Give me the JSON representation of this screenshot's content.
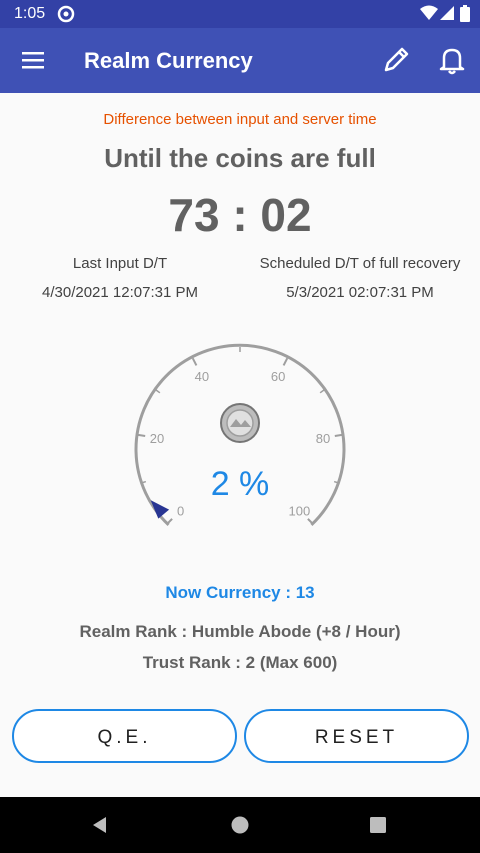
{
  "status": {
    "time": "1:05"
  },
  "appbar": {
    "title": "Realm Currency"
  },
  "main": {
    "difference_note": "Difference between input and server time",
    "heading": "Until the coins are full",
    "countdown": "73 : 02",
    "last_input_label": "Last Input D/T",
    "last_input_value": "4/30/2021 12:07:31 PM",
    "scheduled_label": "Scheduled D/T of full recovery",
    "scheduled_value": "5/3/2021 02:07:31 PM",
    "gauge": {
      "value_percent": 2,
      "percent_text": "2 %",
      "ticks": [
        "0",
        "20",
        "40",
        "60",
        "80",
        "100"
      ]
    },
    "now_currency": "Now Currency : 13",
    "realm_rank": "Realm Rank : Humble Abode (+8 / Hour)",
    "trust_rank": "Trust Rank : 2 (Max 600)",
    "qe_label": "Q.E.",
    "reset_label": "RESET"
  },
  "colors": {
    "primary": "#3f51b5",
    "accent": "#1e88e5",
    "note": "#e65100"
  }
}
